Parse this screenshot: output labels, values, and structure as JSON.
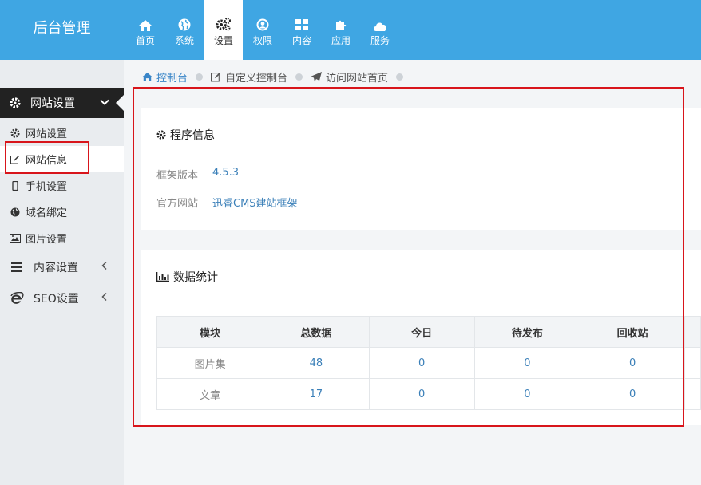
{
  "header": {
    "brand": "后台管理",
    "nav": [
      {
        "label": "首页",
        "icon": "home-icon"
      },
      {
        "label": "系统",
        "icon": "globe-icon"
      },
      {
        "label": "设置",
        "icon": "cogs-icon",
        "active": true
      },
      {
        "label": "权限",
        "icon": "user-circle-icon"
      },
      {
        "label": "内容",
        "icon": "grid-icon"
      },
      {
        "label": "应用",
        "icon": "puzzle-icon"
      },
      {
        "label": "服务",
        "icon": "cloud-icon"
      }
    ]
  },
  "sidebar": {
    "section": {
      "label": "网站设置",
      "icon": "gear-icon"
    },
    "items": [
      {
        "label": "网站设置",
        "icon": "gear-icon"
      },
      {
        "label": "网站信息",
        "icon": "edit-icon",
        "active": true
      },
      {
        "label": "手机设置",
        "icon": "mobile-icon"
      },
      {
        "label": "域名绑定",
        "icon": "globe-icon"
      },
      {
        "label": "图片设置",
        "icon": "picture-icon"
      }
    ],
    "groups": [
      {
        "label": "内容设置",
        "icon": "bars-icon"
      },
      {
        "label": "SEO设置",
        "icon": "ie-icon"
      }
    ]
  },
  "breadcrumb": [
    {
      "label": "控制台",
      "icon": "home-icon"
    },
    {
      "label": "自定义控制台",
      "icon": "edit-icon"
    },
    {
      "label": "访问网站首页",
      "icon": "send-icon"
    }
  ],
  "program_info": {
    "title": "程序信息",
    "rows": [
      {
        "key": "框架版本",
        "value": "4.5.3"
      },
      {
        "key": "官方网站",
        "value": "迅睿CMS建站框架"
      }
    ]
  },
  "stats": {
    "title": "数据统计",
    "columns": [
      "模块",
      "总数据",
      "今日",
      "待发布",
      "回收站"
    ],
    "rows": [
      [
        "图片集",
        "48",
        "0",
        "0",
        "0"
      ],
      [
        "文章",
        "17",
        "0",
        "0",
        "0"
      ]
    ]
  },
  "colors": {
    "header_bg": "#3fa6e3",
    "link": "#3a7fb8",
    "annotation_red": "#d8151b"
  }
}
